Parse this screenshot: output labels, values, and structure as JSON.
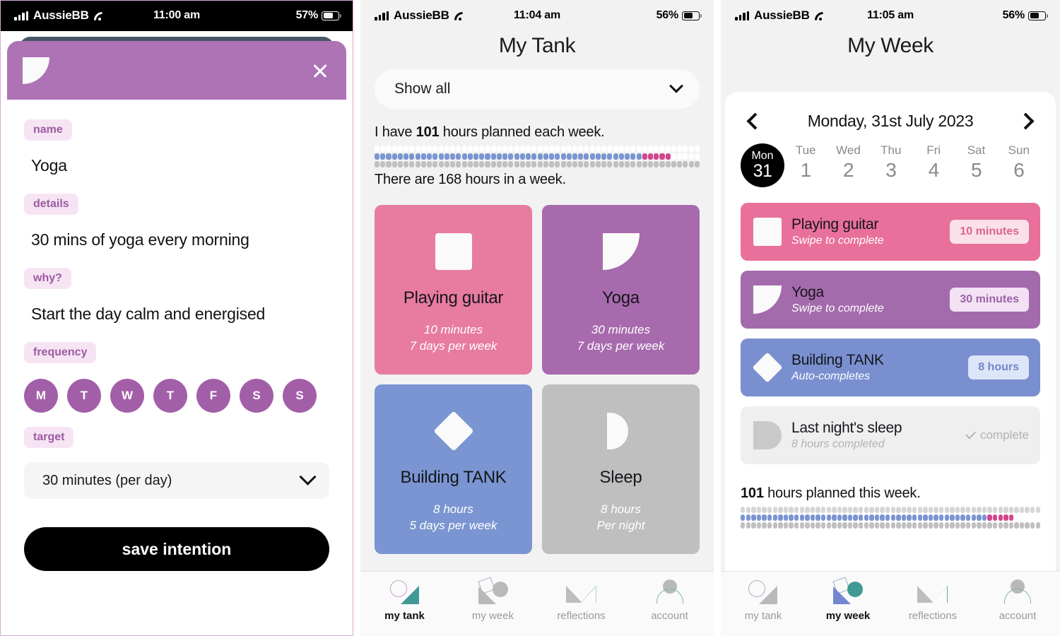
{
  "panel1": {
    "status": {
      "carrier": "AussieBB",
      "time": "11:00 am",
      "battery": "57%"
    },
    "modal": {
      "icon": "quarter-circle-icon",
      "close": "close-icon",
      "fields": [
        {
          "label": "name",
          "value": "Yoga"
        },
        {
          "label": "details",
          "value": "30 mins of yoga every morning"
        },
        {
          "label": "why?",
          "value": "Start the day calm and energised"
        }
      ],
      "frequency_label": "frequency",
      "days": [
        "M",
        "T",
        "W",
        "T",
        "F",
        "S",
        "S"
      ],
      "target_label": "target",
      "target_value": "30 minutes (per day)",
      "save_label": "save intention"
    }
  },
  "panel2": {
    "status": {
      "carrier": "AussieBB",
      "time": "11:04 am",
      "battery": "56%"
    },
    "title": "My Tank",
    "filter_value": "Show all",
    "planned_prefix": "I have ",
    "planned_hours": "101",
    "planned_suffix": " hours planned each week.",
    "total_line": "There are 168 hours in a week.",
    "cards": [
      {
        "title": "Playing guitar",
        "icon": "square-icon",
        "color": "#e87ba0",
        "line1": "10 minutes",
        "line2": "7 days per week"
      },
      {
        "title": "Yoga",
        "icon": "quarter-circle-icon",
        "color": "#a76aad",
        "line1": "30 minutes",
        "line2": "7 days per week"
      },
      {
        "title": "Building TANK",
        "icon": "diamond-icon",
        "color": "#7a95d1",
        "line1": "8 hours",
        "line2": "5 days per week"
      },
      {
        "title": "Sleep",
        "icon": "half-circle-icon",
        "color": "#bfbfbf",
        "line1": "8 hours",
        "line2": "Per night"
      }
    ],
    "tabs": [
      {
        "label": "my tank",
        "icon": "tank-icon",
        "active": true
      },
      {
        "label": "my week",
        "icon": "week-icon",
        "active": false
      },
      {
        "label": "reflections",
        "icon": "reflections-icon",
        "active": false
      },
      {
        "label": "account",
        "icon": "account-icon",
        "active": false
      }
    ]
  },
  "panel3": {
    "status": {
      "carrier": "AussieBB",
      "time": "11:05 am",
      "battery": "56%"
    },
    "title": "My Week",
    "date_title": "Monday, 31st July 2023",
    "prev": "chevron-left-icon",
    "next": "chevron-right-icon",
    "week": [
      {
        "dow": "Mon",
        "num": "31",
        "selected": true
      },
      {
        "dow": "Tue",
        "num": "1",
        "selected": false
      },
      {
        "dow": "Wed",
        "num": "2",
        "selected": false
      },
      {
        "dow": "Thu",
        "num": "3",
        "selected": false
      },
      {
        "dow": "Fri",
        "num": "4",
        "selected": false
      },
      {
        "dow": "Sat",
        "num": "5",
        "selected": false
      },
      {
        "dow": "Sun",
        "num": "6",
        "selected": false
      }
    ],
    "tasks": [
      {
        "title": "Playing guitar",
        "sub": "Swipe to complete",
        "badge": "10 minutes",
        "icon": "square-icon",
        "bg": "#e8709b",
        "badge_bg": "#fbe0ea",
        "badge_fg": "#d9648f",
        "done": false
      },
      {
        "title": "Yoga",
        "sub": "Swipe to complete",
        "badge": "30 minutes",
        "icon": "quarter-circle-icon",
        "bg": "#a46bac",
        "badge_bg": "#f2e2f4",
        "badge_fg": "#9c63a6",
        "done": false
      },
      {
        "title": "Building TANK",
        "sub": "Auto-completes",
        "badge": "8 hours",
        "icon": "diamond-icon",
        "bg": "#7a8fd0",
        "badge_bg": "#dde5f8",
        "badge_fg": "#7387c9",
        "done": false
      },
      {
        "title": "Last night's sleep",
        "sub": "8 hours completed",
        "badge": "complete",
        "icon": "half-circle-icon",
        "bg": "#efefef",
        "badge_bg": "transparent",
        "badge_fg": "#b2b2b2",
        "done": true
      }
    ],
    "planned_hours": "101",
    "planned_suffix": " hours planned this week.",
    "tabs": [
      {
        "label": "my tank",
        "icon": "tank-icon",
        "active": false
      },
      {
        "label": "my week",
        "icon": "week-icon",
        "active": true
      },
      {
        "label": "reflections",
        "icon": "reflections-icon",
        "active": false
      },
      {
        "label": "account",
        "icon": "account-icon",
        "active": false
      }
    ]
  },
  "chart_data": {
    "type": "bar",
    "title": "Weekly hours allocation",
    "total_hours_in_week": 168,
    "planned_hours": 101,
    "segments_total": 56,
    "series": [
      {
        "name": "blue-planned",
        "color": "#7a95d1",
        "count": 46
      },
      {
        "name": "pink-planned",
        "color": "#d1458c",
        "count": 5
      },
      {
        "name": "unplanned",
        "color": "#ffffff",
        "count": 5
      }
    ],
    "rows": [
      "top-empty",
      "planned",
      "bottom-grey"
    ]
  }
}
